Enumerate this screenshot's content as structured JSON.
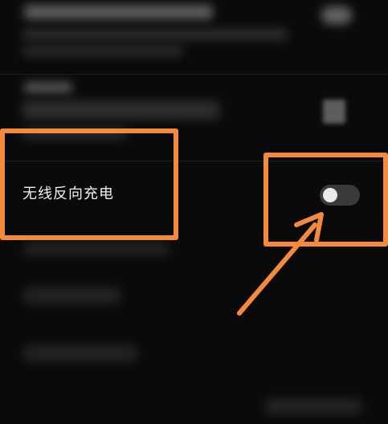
{
  "setting": {
    "label": "无线反向充电",
    "toggle_state": "off"
  },
  "annotations": {
    "accent_color": "#f58a3c",
    "label_box": "highlight",
    "toggle_box": "highlight",
    "arrow": "pointing-to-toggle"
  },
  "colors": {
    "background": "#0a0a0a",
    "toggle_track": "#3a3a3a",
    "toggle_knob": "#e9e9e9",
    "text": "#f0f0f0"
  }
}
